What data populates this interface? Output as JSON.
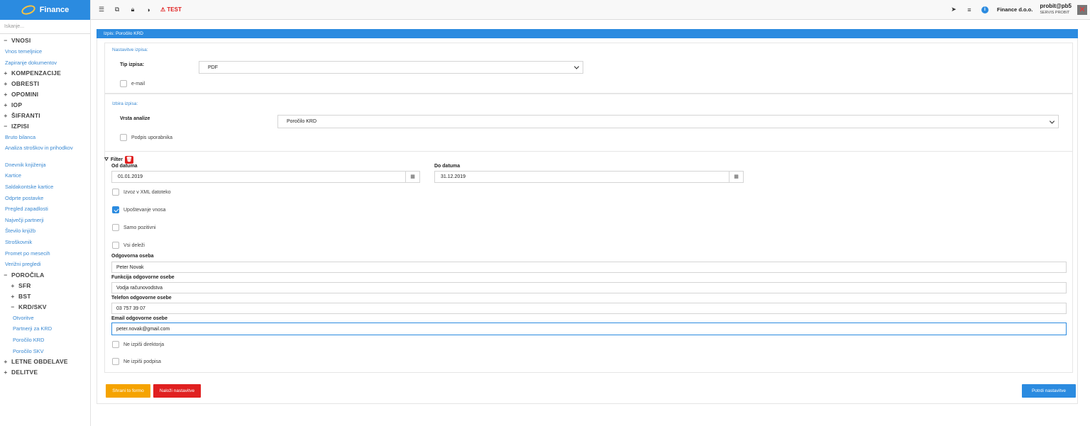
{
  "sidebar": {
    "app_name": "Finance",
    "search_placeholder": "Iskanje...",
    "vnosi": {
      "label": "VNOSI",
      "items": [
        "Vnos temeljnice",
        "Zapiranje dokumentov"
      ]
    },
    "kompenzacije": "KOMPENZACIJE",
    "obresti": "OBRESTI",
    "opomini": "OPOMINI",
    "iop": "IOP",
    "sifranti": "ŠIFRANTI",
    "izpisi": {
      "label": "IZPISI",
      "items": [
        "Bruto bilanca",
        "Analiza stroškov in prihodkov",
        "Dnevnik knjiženja",
        "Kartice",
        "Saldakontske kartice",
        "Odprte postavke",
        "Pregled zapadlosti",
        "Največji partnerji",
        "Število knjižb",
        "Stroškovnik",
        "Promet po mesecih",
        "Verižni pregledi"
      ]
    },
    "porocila": {
      "label": "POROČILA",
      "sfr": "SFR",
      "bst": "BST",
      "krd": {
        "label": "KRD/SKV",
        "items": [
          "Otvoritve",
          "Partnerji za KRD",
          "Poročilo KRD",
          "Poročilo SKV"
        ]
      }
    },
    "letne_obdelave": "LETNE OBDELAVE",
    "delitve": "DELITVE"
  },
  "topbar": {
    "test_label": "TEST",
    "company": "Finance d.o.o.",
    "user": "probit@pb5",
    "user_sub": "SERVIS PROBIT"
  },
  "panel": {
    "title": "Izpis: Poročilo KRD",
    "settings_caption": "Nastavitve izpisa:",
    "tip_label": "Tip izpisa:",
    "tip_value": "PDF",
    "email_label": "e-mail",
    "choice_caption": "Izbira izpisa:",
    "analiza_label": "Vrsta analize",
    "analiza_value": "Poročilo KRD",
    "podpis_label": "Podpis uporabnika",
    "filter_label": "Filter",
    "od_label": "Od datuma",
    "od_value": "01.01.2019",
    "do_label": "Do datuma",
    "do_value": "31.12.2019",
    "xml_label": "Izvoz v XML datoteko",
    "upostevanje_label": "Upoštevanje vnosa",
    "upostevanje_checked": true,
    "pozitivni_label": "Samo pozitivni",
    "delezi_label": "Vsi deleži",
    "oseba_label": "Odgovorna oseba",
    "oseba_value": "Peter Novak",
    "funkcija_label": "Funkcija odgovorne osebe",
    "funkcija_value": "Vodja računovodstva",
    "telefon_label": "Telefon odgovorne osebe",
    "telefon_value": "03 757 39 07",
    "email_osebe_label": "Email odgovorne osebe",
    "email_osebe_value": "peter.novak@gmail.com",
    "direktor_label": "Ne izpiši direktorja",
    "podpisa_label": "Ne izpiši podpisa"
  },
  "buttons": {
    "save": "Shrani to formo",
    "load": "Naloži nastavitve",
    "confirm": "Potrdi nastavitve"
  },
  "colors": {
    "accent": "#2b8be0",
    "save": "#f5a300",
    "load": "#e02020"
  }
}
